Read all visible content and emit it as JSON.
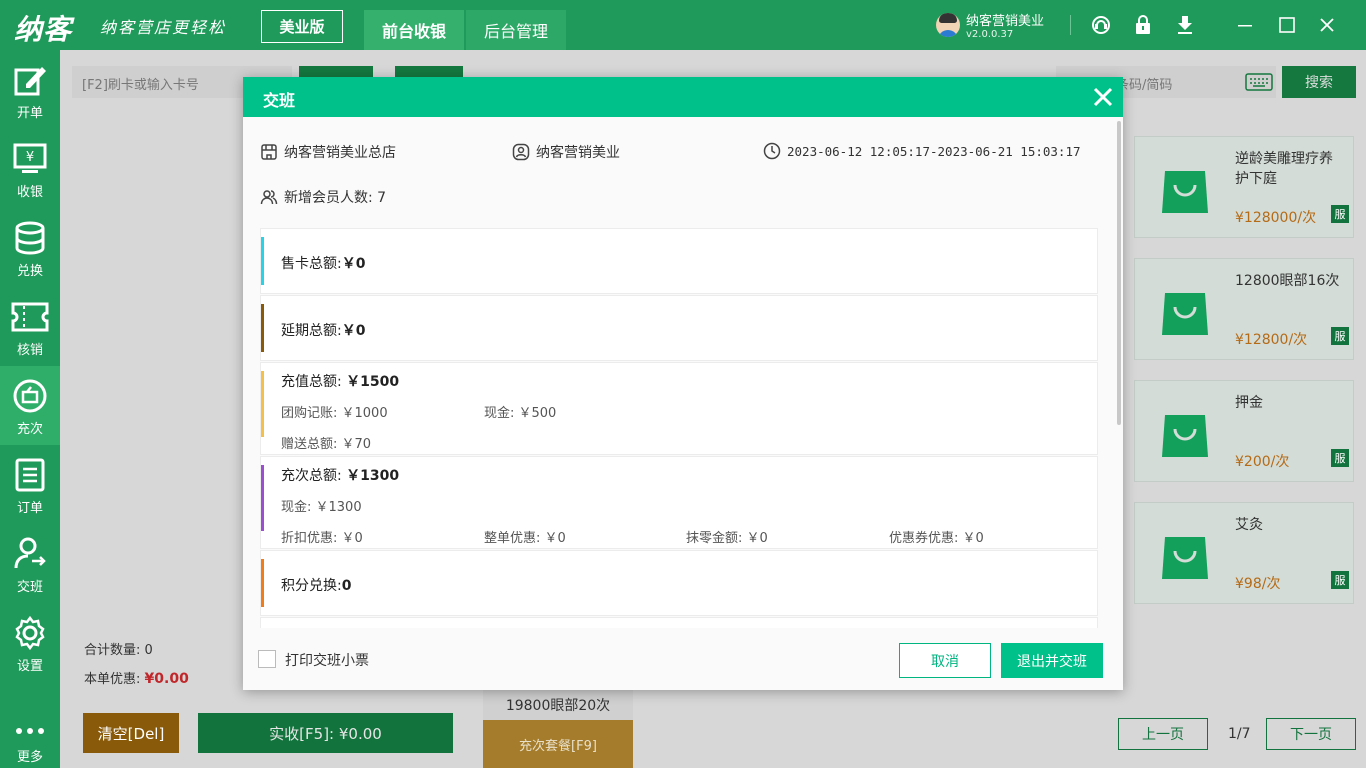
{
  "app": {
    "logo": "纳客",
    "slogan": "纳客营店更轻松",
    "edition_label": "美业版",
    "tabs": [
      {
        "label": "前台收银",
        "active": true
      },
      {
        "label": "后台管理",
        "active": false
      }
    ],
    "user_name": "纳客营销美业",
    "version": "v2.0.0.37",
    "accent_color": "#1f9a5a"
  },
  "sidebar": {
    "items": [
      {
        "label": "开单",
        "icon": "edit-icon"
      },
      {
        "label": "收银",
        "icon": "cashier-icon"
      },
      {
        "label": "兑换",
        "icon": "coins-icon"
      },
      {
        "label": "核销",
        "icon": "ticket-icon"
      },
      {
        "label": "充次",
        "icon": "recharge-icon",
        "active": true
      },
      {
        "label": "订单",
        "icon": "order-icon"
      },
      {
        "label": "交班",
        "icon": "shift-icon"
      },
      {
        "label": "设置",
        "icon": "gear-icon"
      },
      {
        "label": "更多",
        "icon": "more-icon"
      }
    ]
  },
  "left_panel": {
    "card_input_placeholder": "[F2]刷卡或输入卡号",
    "total_qty_label": "合计数量:",
    "total_qty_value": "0",
    "discount_label": "本单优惠:",
    "discount_value": "¥0.00",
    "clear_button": "清空[Del]",
    "pay_button": "实收[F5]: ¥0.00"
  },
  "middle": {
    "bottom_card_name": "19800眼部20次",
    "package_button": "充次套餐[F9]"
  },
  "right_panel": {
    "search_placeholder": "条码/简码",
    "search_button": "搜索",
    "products": [
      {
        "name": "逆龄美雕理疗养护下庭",
        "price": "¥128000/次",
        "tag": "服"
      },
      {
        "name": "12800眼部16次",
        "price": "¥12800/次",
        "tag": "服"
      },
      {
        "name": "押金",
        "price": "¥200/次",
        "tag": "服"
      },
      {
        "name": "艾灸",
        "price": "¥98/次",
        "tag": "服"
      }
    ],
    "prev_page": "上一页",
    "page_indicator": "1/7",
    "next_page": "下一页"
  },
  "modal": {
    "title": "交班",
    "store": "纳客营销美业总店",
    "operator": "纳客营销美业",
    "time_range": "2023-06-12 12:05:17-2023-06-21 15:03:17",
    "new_members": "新增会员人数: 7",
    "sections": {
      "card_sales": {
        "label": "售卡总额:",
        "value": "￥0",
        "color": "#29d3e6"
      },
      "extension": {
        "label": "延期总额:",
        "value": "￥0",
        "color": "#8a5a0b"
      },
      "recharge": {
        "label": "充值总额:",
        "value": "￥1500",
        "color": "#f5c04a",
        "group_buy": "团购记账: ￥1000",
        "cash": "现金: ￥500",
        "gift": "赠送总额: ￥70"
      },
      "recharge_times": {
        "label": "充次总额:",
        "value": "￥1300",
        "color": "#9b4fd0",
        "cash": "现金: ￥1300",
        "discount": "折扣优惠: ￥0",
        "whole_discount": "整单优惠: ￥0",
        "round_off": "抹零金额: ￥0",
        "coupon": "优惠券优惠: ￥0"
      },
      "points": {
        "label": "积分兑换:",
        "value": "0",
        "color": "#f07c1a"
      }
    },
    "print_receipt_label": "打印交班小票",
    "cancel_button": "取消",
    "confirm_button": "退出并交班"
  }
}
